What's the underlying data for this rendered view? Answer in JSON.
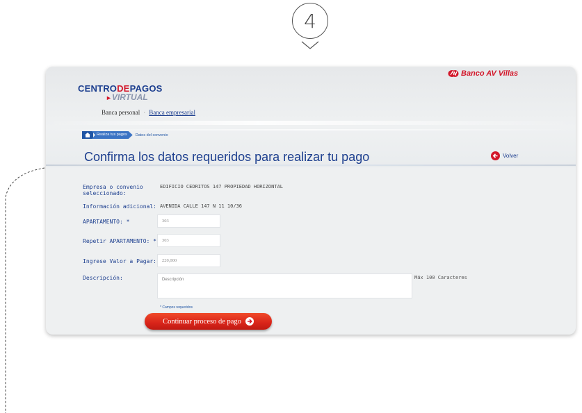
{
  "step": {
    "number": "4"
  },
  "header": {
    "bank_name": "Banco AV Villas",
    "logo": {
      "part1": "CENTRO",
      "part2": "DE",
      "part3": "PAGOS",
      "subtitle": "VIRTUAL"
    },
    "nav": {
      "personal": "Banca personal",
      "separator": "·",
      "business": "Banca empresarial"
    }
  },
  "breadcrumb": {
    "step": "Realiza tus pagos",
    "current": "Datos del convenio"
  },
  "page": {
    "title": "Confirma los datos requeridos para realizar tu pago",
    "back_label": "Volver"
  },
  "form": {
    "company_label": "Empresa o convenio seleccionado:",
    "company_value": "EDIFICIO CEDRITOS 147 PROPIEDAD HORIZONTAL",
    "info_label": "Información adicional:",
    "info_value": "AVENIDA CALLE 147 N 11 10/36",
    "apt_label": "APARTAMENTO: *",
    "apt_value": "303",
    "apt_repeat_label": "Repetir APARTAMENTO: *",
    "apt_repeat_value": "303",
    "amount_label": "Ingrese Valor a Pagar:",
    "amount_value": "220,000",
    "desc_label": "Descripción:",
    "desc_placeholder": "Descripción",
    "max_note": "Máx 100 Caracteres",
    "required_note": "* Campos requeridos",
    "continue_label": "Continuar proceso de pago"
  },
  "colors": {
    "brand_blue": "#1d3f8f",
    "brand_red": "#d3172a",
    "button_red": "#e0321f"
  }
}
